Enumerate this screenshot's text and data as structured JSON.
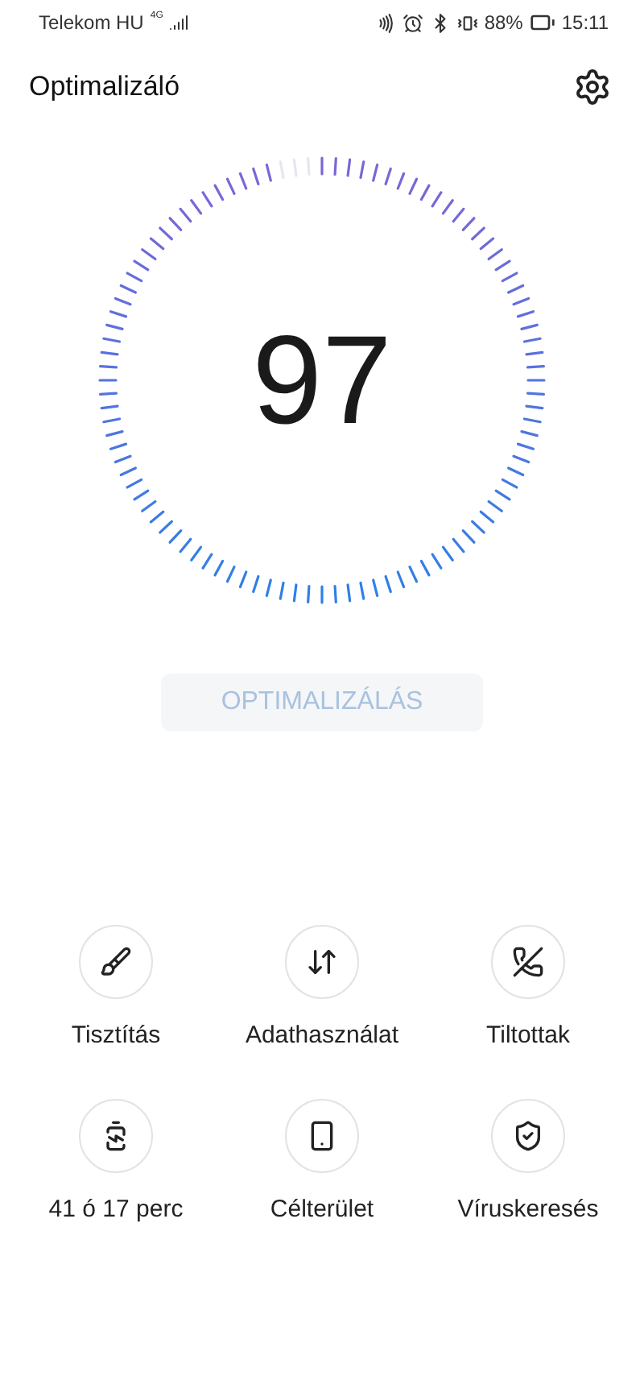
{
  "status_bar": {
    "carrier": "Telekom HU",
    "network": "4G",
    "battery": "88%",
    "time": "15:11"
  },
  "header": {
    "title": "Optimalizáló"
  },
  "gauge": {
    "score": "97"
  },
  "optimize_button": {
    "label": "OPTIMALIZÁLÁS",
    "disabled": true
  },
  "tools": [
    {
      "kind": "clean",
      "label": "Tisztítás"
    },
    {
      "kind": "data",
      "label": "Adathasználat"
    },
    {
      "kind": "blocked",
      "label": "Tiltottak"
    },
    {
      "kind": "battery",
      "label": "41 ó 17 perc"
    },
    {
      "kind": "apps",
      "label": "Célterület"
    },
    {
      "kind": "virus",
      "label": "Víruskeresés"
    }
  ]
}
